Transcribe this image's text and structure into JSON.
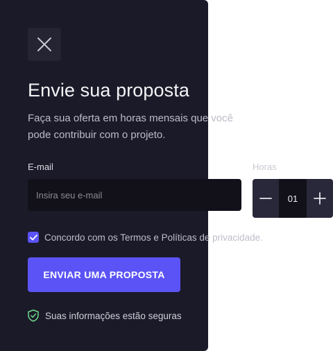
{
  "close_button": {
    "icon": "close-icon"
  },
  "title": "Envie sua proposta",
  "subtitle": {
    "line1": "Faça sua oferta em horas mensais que você",
    "line2": "pode contribuir com o projeto."
  },
  "email": {
    "label": "E-mail",
    "placeholder": "Insira seu e-mail",
    "value": ""
  },
  "hours": {
    "label": "Horas",
    "value": "01",
    "decrement_icon": "minus-icon",
    "increment_icon": "plus-icon"
  },
  "agreement": {
    "checked": true,
    "label": "Concordo com os Termos e Políticas de privacidade."
  },
  "submit_label": "ENVIAR UMA PROPOSTA",
  "secure_note": {
    "icon": "shield-check-icon",
    "label": "Suas informações estão seguras"
  },
  "colors": {
    "panel_background": "#1b1a29",
    "accent": "#5b53f5",
    "input_background": "#121119",
    "secure_icon": "#6fdc8c"
  }
}
